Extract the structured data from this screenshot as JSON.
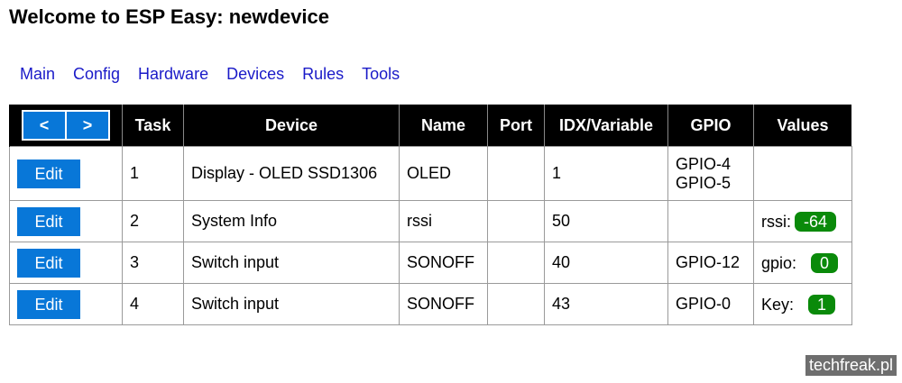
{
  "page": {
    "title": "Welcome to ESP Easy: newdevice"
  },
  "nav": {
    "items": [
      {
        "label": "Main"
      },
      {
        "label": "Config"
      },
      {
        "label": "Hardware"
      },
      {
        "label": "Devices"
      },
      {
        "label": "Rules"
      },
      {
        "label": "Tools"
      }
    ]
  },
  "table": {
    "pager": {
      "prev": "<",
      "next": ">"
    },
    "headers": {
      "task": "Task",
      "device": "Device",
      "name": "Name",
      "port": "Port",
      "idx": "IDX/Variable",
      "gpio": "GPIO",
      "values": "Values"
    },
    "rows": [
      {
        "edit": "Edit",
        "task": "1",
        "device": "Display - OLED SSD1306",
        "name": "OLED",
        "port": "",
        "idx": "1",
        "gpio": [
          "GPIO-4",
          "GPIO-5"
        ],
        "value_label": "",
        "value": ""
      },
      {
        "edit": "Edit",
        "task": "2",
        "device": "System Info",
        "name": "rssi",
        "port": "",
        "idx": "50",
        "gpio": [
          "",
          ""
        ],
        "value_label": "rssi:",
        "value": "-64"
      },
      {
        "edit": "Edit",
        "task": "3",
        "device": "Switch input",
        "name": "SONOFF",
        "port": "",
        "idx": "40",
        "gpio": [
          "GPIO-12",
          ""
        ],
        "value_label": "gpio:",
        "value": "0"
      },
      {
        "edit": "Edit",
        "task": "4",
        "device": "Switch input",
        "name": "SONOFF",
        "port": "",
        "idx": "43",
        "gpio": [
          "GPIO-0",
          ""
        ],
        "value_label": "Key:",
        "value": "1"
      }
    ]
  },
  "watermark": "techfreak.pl",
  "colors": {
    "button_blue": "#0877d8",
    "badge_green": "#0a8a0a",
    "link_blue": "#1a1ac8",
    "header_black": "#000000"
  }
}
